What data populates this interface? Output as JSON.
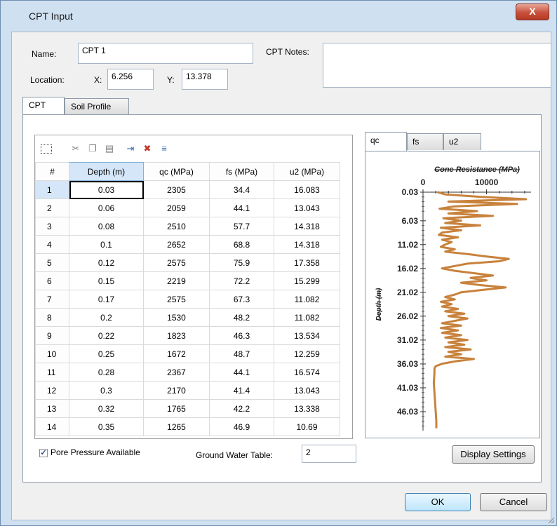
{
  "window": {
    "title": "CPT Input",
    "close_glyph": "X"
  },
  "form": {
    "name_label": "Name:",
    "name_value": "CPT 1",
    "notes_label": "CPT Notes:",
    "notes_value": "",
    "location_label": "Location:",
    "x_label": "X:",
    "x_value": "6.256",
    "y_label": "Y:",
    "y_value": "13.378"
  },
  "tabs": [
    {
      "label": "CPT",
      "active": true
    },
    {
      "label": "Soil Profile",
      "active": false
    }
  ],
  "toolbar": {
    "icons": [
      "select-all-icon",
      "cut-icon",
      "copy-icon",
      "paste-icon",
      "insert-row-icon",
      "delete-row-icon",
      "append-row-icon"
    ]
  },
  "table": {
    "columns": [
      "#",
      "Depth (m)",
      "qc (MPa)",
      "fs (MPa)",
      "u2 (MPa)"
    ],
    "rows": [
      [
        "1",
        "0.03",
        "2305",
        "34.4",
        "16.083"
      ],
      [
        "2",
        "0.06",
        "2059",
        "44.1",
        "13.043"
      ],
      [
        "3",
        "0.08",
        "2510",
        "57.7",
        "14.318"
      ],
      [
        "4",
        "0.1",
        "2652",
        "68.8",
        "14.318"
      ],
      [
        "5",
        "0.12",
        "2575",
        "75.9",
        "17.358"
      ],
      [
        "6",
        "0.15",
        "2219",
        "72.2",
        "15.299"
      ],
      [
        "7",
        "0.17",
        "2575",
        "67.3",
        "11.082"
      ],
      [
        "8",
        "0.2",
        "1530",
        "48.2",
        "11.082"
      ],
      [
        "9",
        "0.22",
        "1823",
        "46.3",
        "13.534"
      ],
      [
        "10",
        "0.25",
        "1672",
        "48.7",
        "12.259"
      ],
      [
        "11",
        "0.28",
        "2367",
        "44.1",
        "16.574"
      ],
      [
        "12",
        "0.3",
        "2170",
        "41.4",
        "13.043"
      ],
      [
        "13",
        "0.32",
        "1765",
        "42.2",
        "13.338"
      ],
      [
        "14",
        "0.35",
        "1265",
        "46.9",
        "10.69"
      ]
    ]
  },
  "pore_pressure": {
    "label": "Pore Pressure Available",
    "checked": true
  },
  "ground_water": {
    "label": "Ground Water Table:",
    "value": "2"
  },
  "chart_tabs": [
    "qc",
    "fs",
    "u2"
  ],
  "display_settings_label": "Display Settings",
  "ok_label": "OK",
  "cancel_label": "Cancel",
  "chart_data": {
    "type": "line",
    "title": "Cone Resistance (MPa)",
    "ylabel": "Depth (m)",
    "xlabel": "",
    "x_ticks": [
      "0",
      "10000"
    ],
    "y_ticks": [
      "0.03",
      "6.03",
      "11.02",
      "16.02",
      "21.02",
      "26.02",
      "31.02",
      "36.03",
      "41.03",
      "46.03"
    ],
    "xlim": [
      0,
      17000
    ],
    "ylim": [
      0.03,
      50
    ],
    "y_inverted": true,
    "line_color": "#c8823c",
    "series": [
      {
        "depth": [
          0.03,
          0.5,
          1.0,
          1.5,
          2.0,
          2.5,
          3.0,
          3.5,
          4.0,
          4.5,
          5.0,
          5.5,
          6.0,
          6.5,
          7.0,
          7.5,
          8.0,
          8.5,
          9.0,
          9.5,
          10.0,
          10.5,
          11.0,
          11.5,
          12.0,
          12.5,
          13.0,
          13.5,
          14.0,
          14.5,
          15.0,
          15.5,
          16.0,
          16.5,
          17.0,
          17.5,
          18.0,
          18.5,
          19.0,
          19.5,
          20.0,
          20.5,
          21.0,
          21.5,
          22.0,
          22.5,
          23.0,
          23.5,
          24.0,
          24.5,
          25.0,
          25.5,
          26.0,
          26.5,
          27.0,
          27.5,
          28.0,
          28.5,
          29.0,
          29.5,
          30.0,
          30.5,
          31.0,
          31.5,
          32.0,
          32.5,
          33.0,
          33.5,
          34.0,
          34.5,
          35.0,
          35.5,
          36.0,
          36.5,
          37.0,
          38.0,
          40.0,
          42.0,
          44.0,
          46.0,
          48.0,
          49.5
        ],
        "qc": [
          2305,
          3500,
          9000,
          16200,
          4000,
          14800,
          5000,
          2600,
          8500,
          4000,
          11000,
          3200,
          6000,
          3500,
          9000,
          2800,
          6000,
          3000,
          2500,
          5500,
          3000,
          4500,
          3500,
          2800,
          5000,
          3500,
          7000,
          10000,
          13500,
          12000,
          7000,
          5000,
          3000,
          5000,
          8000,
          11000,
          7500,
          10000,
          6000,
          9000,
          13000,
          9500,
          6000,
          5000,
          3500,
          5000,
          2800,
          4500,
          3000,
          5500,
          3500,
          6500,
          4000,
          7000,
          5000,
          3000,
          6000,
          2800,
          5500,
          3000,
          6000,
          3500,
          7000,
          4000,
          6500,
          3500,
          7500,
          4000,
          6000,
          3500,
          8000,
          5000,
          3000,
          2000,
          1800,
          1800,
          1700,
          1800,
          1900,
          2000,
          2100,
          2100
        ]
      }
    ]
  }
}
